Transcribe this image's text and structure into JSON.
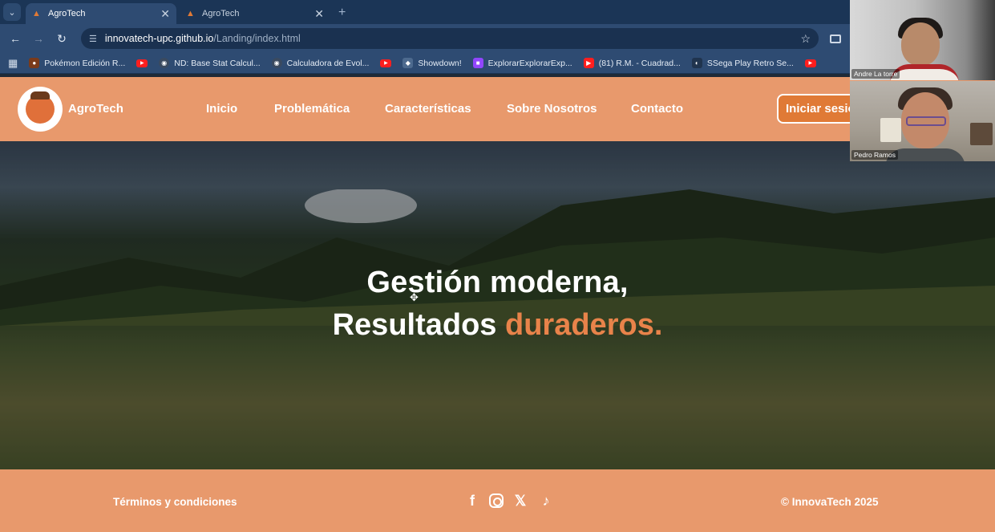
{
  "browser": {
    "tabs": [
      {
        "title": "AgroTech",
        "active": true
      },
      {
        "title": "AgroTech",
        "active": false
      }
    ],
    "url_host": "innovatech-upc.github.io",
    "url_path": "/Landing/index.html",
    "bookmarks": [
      {
        "label": "Pokémon Edición R..."
      },
      {
        "label": "ND: Base Stat Calcul..."
      },
      {
        "label": "Calculadora de Evol..."
      },
      {
        "label": "Showdown!"
      },
      {
        "label": "ExplorarExplorarExp..."
      },
      {
        "label": "(81) R.M. - Cuadrad..."
      },
      {
        "label": "SSega Play Retro Se..."
      }
    ]
  },
  "site": {
    "brand": "AgroTech",
    "nav": [
      "Inicio",
      "Problemática",
      "Características",
      "Sobre Nosotros",
      "Contacto"
    ],
    "login_label": "Iniciar sesión",
    "hero": {
      "line1": "Gestión moderna,",
      "line2_main": "Resultados",
      "line2_accent": "duraderos."
    },
    "footer": {
      "terms": "Términos y condiciones",
      "copyright": "© InnovaTech 2025",
      "social_icons": [
        "facebook-icon",
        "instagram-icon",
        "x-icon",
        "tiktok-icon"
      ]
    },
    "colors": {
      "nav_bg": "#e8996c",
      "accent": "#e8834a",
      "button": "#e07a36"
    }
  },
  "meeting": {
    "participants": [
      {
        "name": "Andre La torre"
      },
      {
        "name": "Pedro Ramos"
      }
    ]
  }
}
